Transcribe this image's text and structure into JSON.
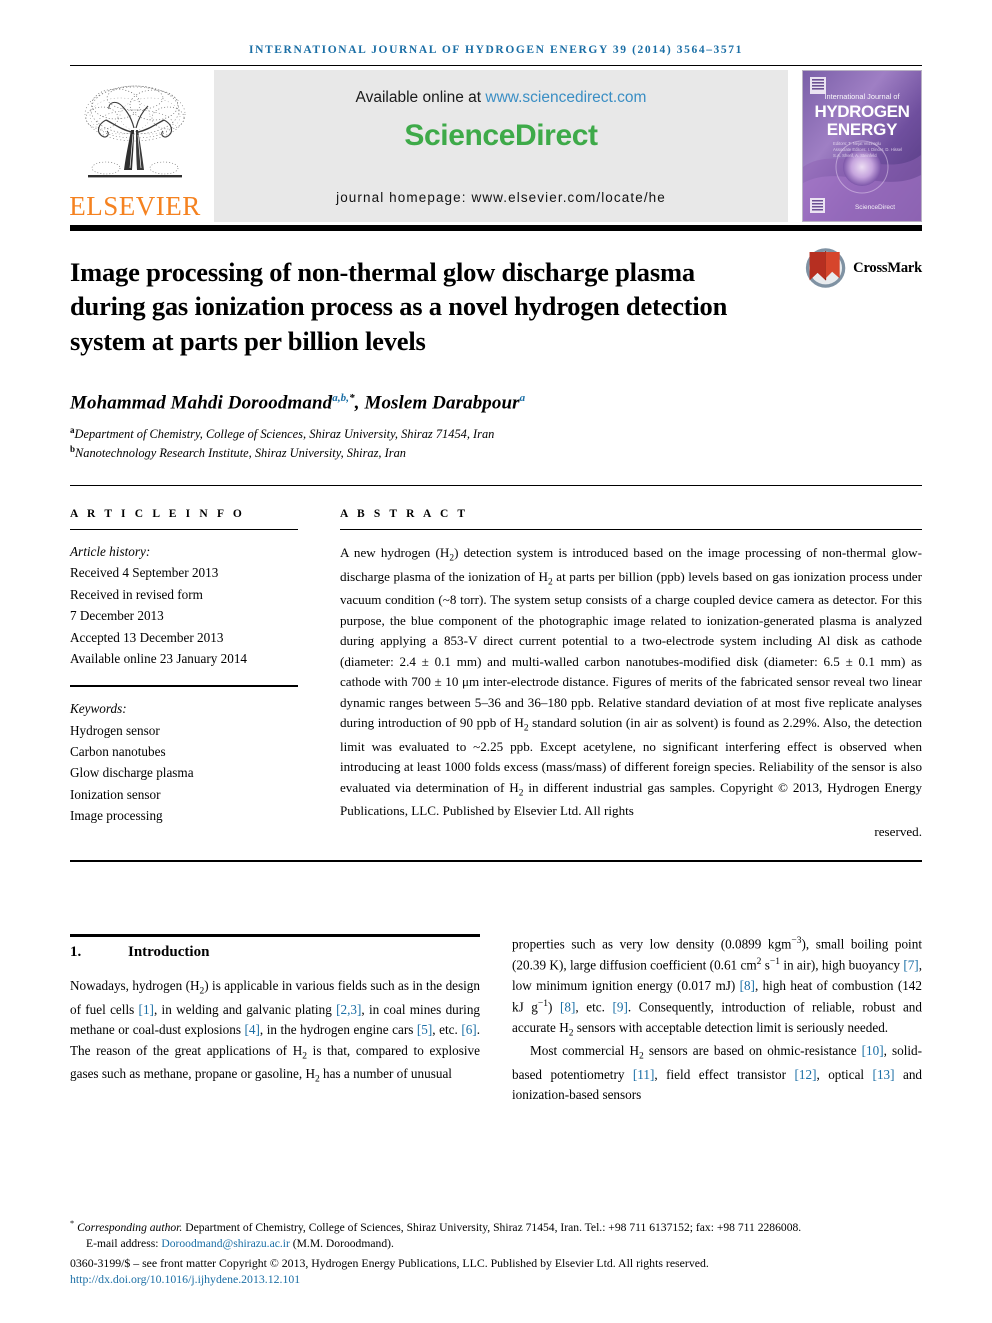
{
  "running_head": "INTERNATIONAL JOURNAL OF HYDROGEN ENERGY 39 (2014) 3564–3571",
  "masthead": {
    "publisher": "ELSEVIER",
    "available_prefix": "Available online at ",
    "available_url": "www.sciencedirect.com",
    "sciencedirect_logo": "ScienceDirect",
    "journal_homepage": "journal homepage: www.elsevier.com/locate/he",
    "cover": {
      "line_small": "International Journal of",
      "line_big_1": "HYDROGEN",
      "line_big_2": "ENERGY",
      "footer": "ScienceDirect"
    }
  },
  "crossmark": {
    "label": "CrossMark"
  },
  "title": "Image processing of non-thermal glow discharge plasma during gas ionization process as a novel hydrogen detection system at parts per billion levels",
  "authors": {
    "author_1_name": "Mohammad Mahdi Doroodmand",
    "author_1_marks": "a,b,",
    "author_1_star": "*",
    "separator": ", ",
    "author_2_name": "Moslem Darabpour",
    "author_2_marks": "a"
  },
  "affiliations": [
    {
      "mark": "a",
      "text": "Department of Chemistry, College of Sciences, Shiraz University, Shiraz 71454, Iran"
    },
    {
      "mark": "b",
      "text": "Nanotechnology Research Institute, Shiraz University, Shiraz, Iran"
    }
  ],
  "article_info": {
    "heading": "A R T I C L E  I N F O",
    "history_label": "Article history:",
    "history": [
      "Received 4 September 2013",
      "Received in revised form",
      "7 December 2013",
      "Accepted 13 December 2013",
      "Available online 23 January 2014"
    ],
    "keywords_label": "Keywords:",
    "keywords": [
      "Hydrogen sensor",
      "Carbon nanotubes",
      "Glow discharge plasma",
      "Ionization sensor",
      "Image processing"
    ]
  },
  "abstract": {
    "heading": "A B S T R A C T",
    "body_1": "A new hydrogen (H",
    "body_2": ") detection system is introduced based on the image processing of non-thermal glow-discharge plasma of the ionization of H",
    "body_3": " at parts per billion (ppb) levels based on gas ionization process under vacuum condition (~8 torr). The system setup consists of a charge coupled device camera as detector. For this purpose, the blue component of the photographic image related to ionization-generated plasma is analyzed during applying a 853-V direct current potential to a two-electrode system including Al disk as cathode (diameter: 2.4 ± 0.1 mm) and multi-walled carbon nanotubes-modified disk (diameter: 6.5 ± 0.1 mm) as cathode with 700 ± 10 μm inter-electrode distance. Figures of merits of the fabricated sensor reveal two linear dynamic ranges between 5–36 and 36–180 ppb. Relative standard deviation of at most five replicate analyses during introduction of 90 ppb of H",
    "body_4": " standard solution (in air as solvent) is found as 2.29%. Also, the detection limit was evaluated to ~2.25 ppb. Except acetylene, no significant interfering effect is observed when introducing at least 1000 folds excess (mass/mass) of different foreign species. Reliability of the sensor is also evaluated via determination of H",
    "body_5": " in different industrial gas samples. Copyright © 2013, Hydrogen Energy Publications, LLC. Published by Elsevier Ltd. All rights",
    "body_last": "reserved."
  },
  "section": {
    "number": "1.",
    "title": "Introduction"
  },
  "intro_left": {
    "p1_a": "Nowadays, hydrogen (H",
    "p1_b": ") is applicable in various fields such as in the design of fuel cells ",
    "c1": "[1]",
    "p1_c": ", in welding and galvanic plating ",
    "c2": "[2,3]",
    "p1_d": ", in coal mines during methane or coal-dust explosions ",
    "c3": "[4]",
    "p1_e": ", in the hydrogen engine cars ",
    "c4": "[5]",
    "p1_f": ", etc. ",
    "c5": "[6]",
    "p1_g": ". The reason of the great applications of H",
    "p1_h": " is that, compared to explosive gases such as methane, propane or gasoline, H",
    "p1_i": " has a number of unusual"
  },
  "intro_right": {
    "p1_a": "properties such as very low density (0.0899 kgm",
    "sup1": "−3",
    "p1_b": "), small boiling point (20.39 K), large diffusion coefficient (0.61 cm",
    "sup2": "2",
    "p1_c": " s",
    "sup3": "−1",
    "p1_d": " in air), high buoyancy ",
    "c7": "[7]",
    "p1_e": ", low minimum ignition energy (0.017 mJ) ",
    "c8": "[8]",
    "p1_f": ", high heat of combustion (142 kJ g",
    "sup4": "−1",
    "p1_g": ") ",
    "c8b": "[8]",
    "p1_h": ", etc. ",
    "c9": "[9]",
    "p1_i": ". Consequently, introduction of reliable, robust and accurate H",
    "p1_j": " sensors with acceptable detection limit is seriously needed.",
    "p2_a": "Most commercial H",
    "p2_b": " sensors are based on ohmic-resistance ",
    "c10": "[10]",
    "p2_c": ", solid-based potentiometry ",
    "c11": "[11]",
    "p2_d": ", field effect transistor ",
    "c12": "[12]",
    "p2_e": ", optical ",
    "c13": "[13]",
    "p2_f": " and ionization-based sensors"
  },
  "footnotes": {
    "corresponding_mark": "*",
    "corresponding_label": "Corresponding author.",
    "corresponding_rest": " Department of Chemistry, College of Sciences, Shiraz University, Shiraz 71454, Iran. Tel.: +98 711 6137152; fax: +98 711 2286008.",
    "email_label": "E-mail address: ",
    "email": "Doroodmand@shirazu.ac.ir",
    "email_attrib": " (M.M. Doroodmand).",
    "front_matter": "0360-3199/$ – see front matter Copyright © 2013, Hydrogen Energy Publications, LLC. Published by Elsevier Ltd. All rights reserved.",
    "doi": "http://dx.doi.org/10.1016/j.ijhydene.2013.12.101"
  },
  "colors": {
    "link_blue": "#1a6ea5",
    "elsevier_orange": "#f58220",
    "sciencedirect_green": "#3eaa49",
    "banner_gray": "#e8e8e8"
  }
}
